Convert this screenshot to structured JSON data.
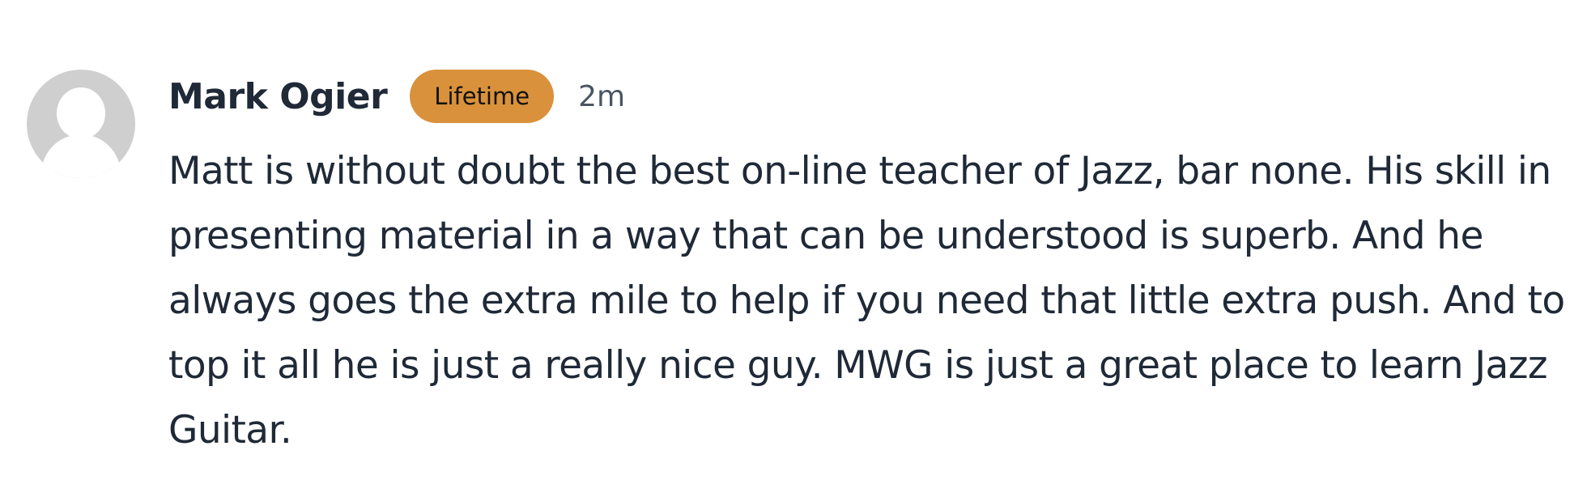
{
  "comment": {
    "author_name": "Mark Ogier",
    "badge": "Lifetime",
    "timestamp": "2m",
    "text": "Matt is without doubt the best on-line teacher of Jazz, bar none. His skill in presenting material in a way that can be understood is superb. And he always goes the extra mile to help if you need that little extra push. And to top it all he is just a really nice guy. MWG is just a great place to learn Jazz Guitar."
  },
  "icons": {
    "avatar": "default-user-avatar-icon"
  },
  "colors": {
    "badge_background": "#d9913b",
    "text_primary": "#1f2937",
    "text_muted": "#4b5563",
    "avatar_background": "#cfcfcf"
  }
}
